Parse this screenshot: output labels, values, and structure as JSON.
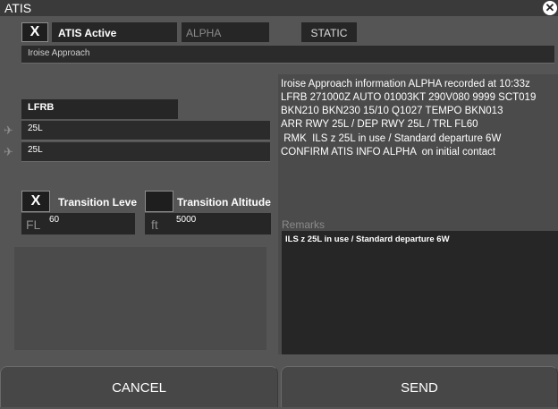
{
  "window": {
    "title": "ATIS",
    "close_icon": "close-icon"
  },
  "atis": {
    "active_check": "X",
    "active_label": "ATIS Active",
    "letter": "ALPHA",
    "mode": "STATIC",
    "station_name": "Iroise Approach",
    "airport": "LFRB",
    "arrival_runway": "25L",
    "departure_runway": "25L",
    "arrival_icon": "plane-landing-icon",
    "departure_icon": "plane-takeoff-icon"
  },
  "transition": {
    "level_check": "X",
    "level_label": "Transition Leve",
    "level_unit": "FL",
    "level_value": "60",
    "altitude_check": "",
    "altitude_label": "Transition Altitude",
    "altitude_unit": "ft",
    "altitude_value": "5000"
  },
  "message": {
    "lines": [
      "Iroise Approach information ALPHA recorded at 10:33z",
      "LFRB 271000Z AUTO 01003KT 290V080 9999 SCT019",
      "BKN210 BKN230 15/10 Q1027 TEMPO BKN013",
      "ARR RWY 25L / DEP RWY 25L / TRL FL60",
      " RMK  ILS z 25L in use / Standard departure 6W",
      "CONFIRM ATIS INFO ALPHA  on initial contact"
    ]
  },
  "remarks": {
    "label": "Remarks",
    "value": "ILS z 25L in use / Standard departure 6W"
  },
  "buttons": {
    "cancel": "CANCEL",
    "send": "SEND"
  }
}
